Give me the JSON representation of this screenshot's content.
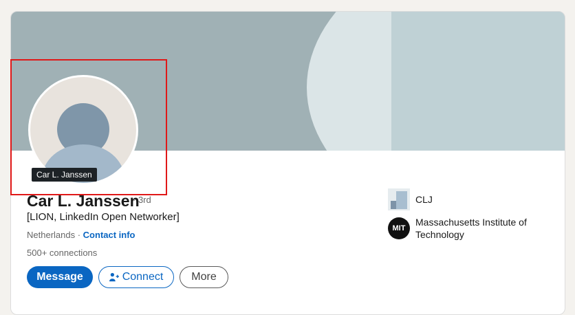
{
  "profile": {
    "name": "Car L. Janssen",
    "degree": "· 3rd",
    "headline": "[LION, LinkedIn Open Networker]",
    "location": "Netherlands",
    "separator": " · ",
    "contact_info": "Contact info",
    "connections": "500+ connections",
    "tooltip": "Car L. Janssen"
  },
  "actions": {
    "message": "Message",
    "connect": "Connect",
    "more": "More"
  },
  "side": {
    "company": "CLJ",
    "education": "Massachusetts Institute of Technology",
    "education_logo_text": "MIT"
  },
  "colors": {
    "accent": "#0a66c2",
    "highlight": "#e01818"
  }
}
